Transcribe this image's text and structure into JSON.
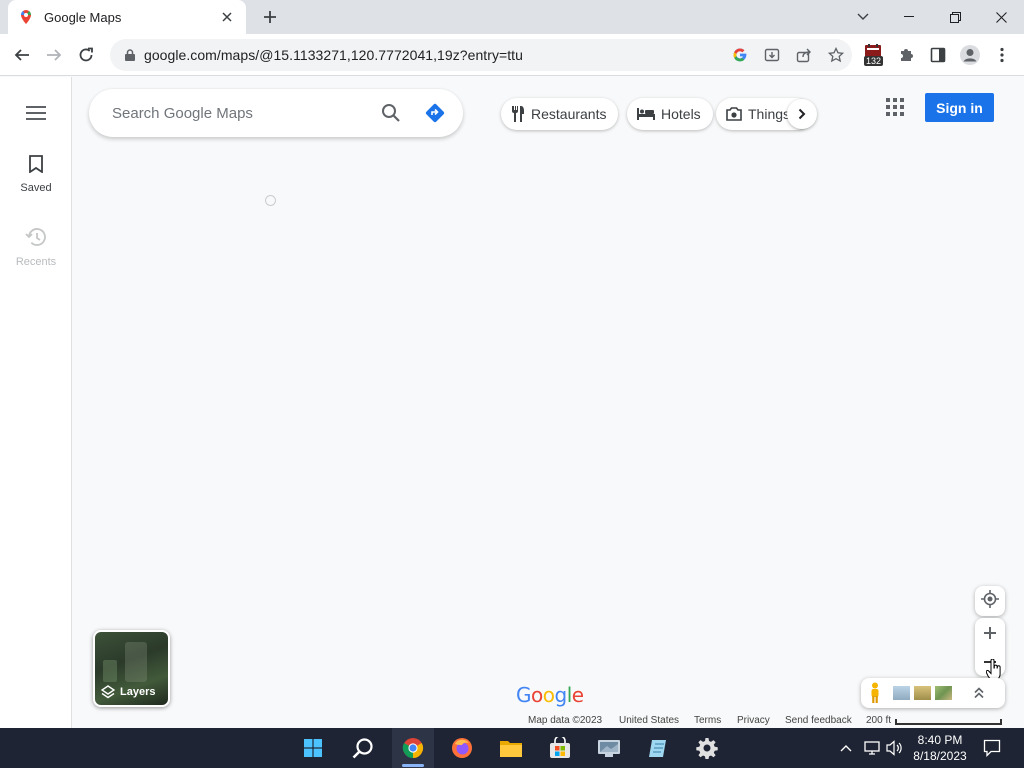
{
  "browser": {
    "tab_title": "Google Maps",
    "url": "google.com/maps/@15.1133271,120.7772041,19z?entry=ttu",
    "extension_badge": "132"
  },
  "rail": {
    "saved_label": "Saved",
    "recents_label": "Recents"
  },
  "search": {
    "placeholder": "Search Google Maps"
  },
  "chips": [
    {
      "label": "Restaurants",
      "icon": "fork-knife-icon"
    },
    {
      "label": "Hotels",
      "icon": "bed-icon"
    },
    {
      "label": "Things",
      "icon": "camera-icon"
    }
  ],
  "signin_label": "Sign in",
  "layers_label": "Layers",
  "logo_text": "Google",
  "footer": {
    "map_data": "Map data ©2023",
    "country": "United States",
    "terms": "Terms",
    "privacy": "Privacy",
    "feedback": "Send feedback",
    "scale": "200 ft"
  },
  "clock": {
    "time": "8:40 PM",
    "date": "8/18/2023"
  },
  "colors": {
    "accent": "#1a73e8",
    "taskbar": "#1e2433"
  }
}
